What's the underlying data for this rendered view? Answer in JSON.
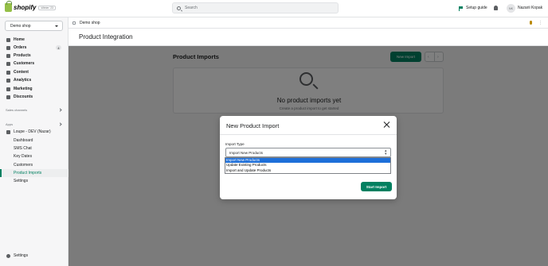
{
  "topbar": {
    "logo_text": "shopify",
    "logo_version": "Winter '23",
    "search_placeholder": "Search",
    "setup_guide": "Setup guide",
    "avatar_initials": "NK",
    "user_name": "Nazarii Kopak"
  },
  "sidebar": {
    "store": "Demo shop",
    "nav": [
      {
        "label": "Home",
        "icon": "home-icon"
      },
      {
        "label": "Orders",
        "icon": "orders-icon",
        "badge": "4"
      },
      {
        "label": "Products",
        "icon": "tag-icon"
      },
      {
        "label": "Customers",
        "icon": "person-icon"
      },
      {
        "label": "Content",
        "icon": "content-icon"
      },
      {
        "label": "Analytics",
        "icon": "analytics-icon"
      },
      {
        "label": "Marketing",
        "icon": "marketing-icon"
      },
      {
        "label": "Discounts",
        "icon": "discount-icon"
      }
    ],
    "sales_channels": "Sales channels",
    "apps": "Apps",
    "app_name": "Loupe - DEV (Nazar)",
    "app_items": [
      "Dashboard",
      "SMS Chat",
      "Key Dates",
      "Customers",
      "Product Imports",
      "Settings"
    ],
    "active_app_item": "Product Imports",
    "settings": "Settings"
  },
  "main": {
    "breadcrumb": "Demo shop",
    "page_title": "Product Integration",
    "content_title": "Product Imports",
    "new_import_label": "New Import",
    "pager_prev": "‹",
    "pager_next": "›",
    "empty_title": "No product imports yet",
    "empty_subtitle": "Create a product import to get started"
  },
  "modal": {
    "title": "New Product Import",
    "field_label": "Import Type",
    "select_value": "Import New Products",
    "options": [
      "Import New Products",
      "Update Existing Products",
      "Import and Update Products"
    ],
    "selected_index": 0,
    "start_label": "Start Import"
  },
  "colors": {
    "primary": "#008060",
    "overlay": "rgba(0,0,0,0.5)",
    "selected_option": "#1e6fd9"
  }
}
